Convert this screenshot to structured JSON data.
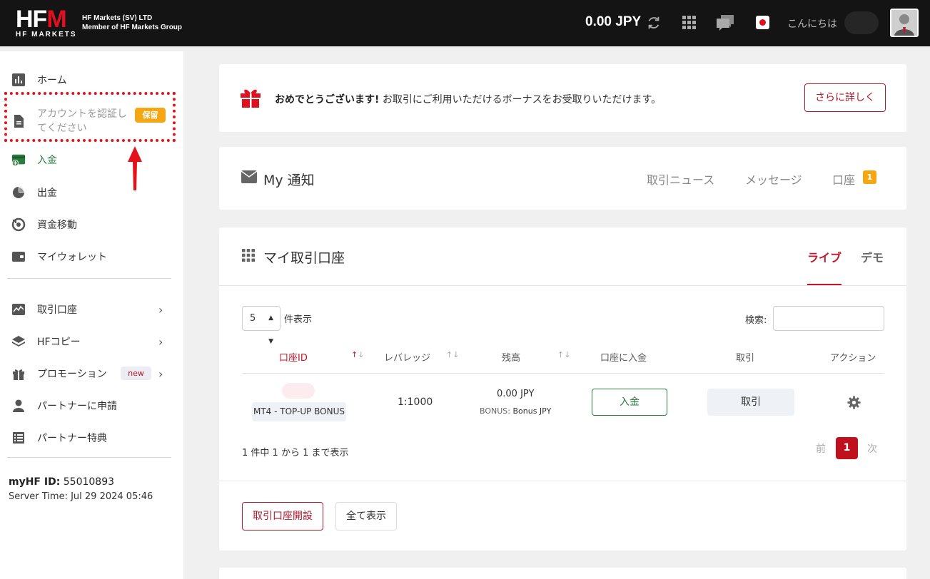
{
  "header": {
    "logo_text": "HF",
    "logo_m": "M",
    "logo_sub": "HF MARKETS",
    "company_line1": "HF Markets (SV) LTD",
    "company_line2": "Member of HF Markets Group",
    "balance": "0.00 JPY",
    "greeting": "こんにちは"
  },
  "sidebar": {
    "items": [
      {
        "label": "ホーム",
        "icon": "bar-chart-icon"
      },
      {
        "label": "アカウントを認証してください",
        "icon": "document-icon",
        "badge": "保留"
      },
      {
        "label": "入金",
        "icon": "deposit-icon"
      },
      {
        "label": "出金",
        "icon": "withdraw-icon"
      },
      {
        "label": "資金移動",
        "icon": "transfer-icon"
      },
      {
        "label": "マイウォレット",
        "icon": "wallet-icon"
      },
      {
        "label": "取引口座",
        "icon": "chart-line-icon"
      },
      {
        "label": "HFコピー",
        "icon": "layers-icon"
      },
      {
        "label": "プロモーション",
        "icon": "gift-icon",
        "badge": "new"
      },
      {
        "label": "パートナーに申請",
        "icon": "user-icon"
      },
      {
        "label": "パートナー特典",
        "icon": "list-icon"
      }
    ],
    "myhf_label": "myHF ID:",
    "myhf_id": "55010893",
    "server_time": "Server Time: Jul 29 2024 05:46"
  },
  "bonus": {
    "bold": "おめでとうございます!",
    "text": "お取引にご利用いただけるボーナスをお受取りいただけます。",
    "button": "さらに詳しく"
  },
  "notifications": {
    "title": "My 通知",
    "tabs": [
      "取引ニュース",
      "メッセージ",
      "口座"
    ],
    "badge": "1"
  },
  "accounts": {
    "title": "マイ取引口座",
    "tab_live": "ライブ",
    "tab_demo": "デモ",
    "page_size": "5",
    "page_size_label": "件表示",
    "search_label": "検索:",
    "columns": [
      "口座ID",
      "レバレッジ",
      "残高",
      "口座に入金",
      "取引",
      "アクション"
    ],
    "rows": [
      {
        "type": "MT4 - TOP-UP BONUS",
        "leverage": "1:1000",
        "balance": "0.00 JPY",
        "bonus_key": "BONUS:",
        "bonus_val": "Bonus JPY",
        "deposit": "入金",
        "trade": "取引"
      }
    ],
    "count_text": "1 件中 1 から 1 まで表示",
    "pager_prev": "前",
    "pager_current": "1",
    "pager_next": "次",
    "open_button": "取引口座開設",
    "all_button": "全て表示"
  },
  "colors": {
    "brand_red": "#c0172b",
    "topbar": "#141414",
    "warning": "#f5a614",
    "deposit_green": "#2a7d3e"
  }
}
